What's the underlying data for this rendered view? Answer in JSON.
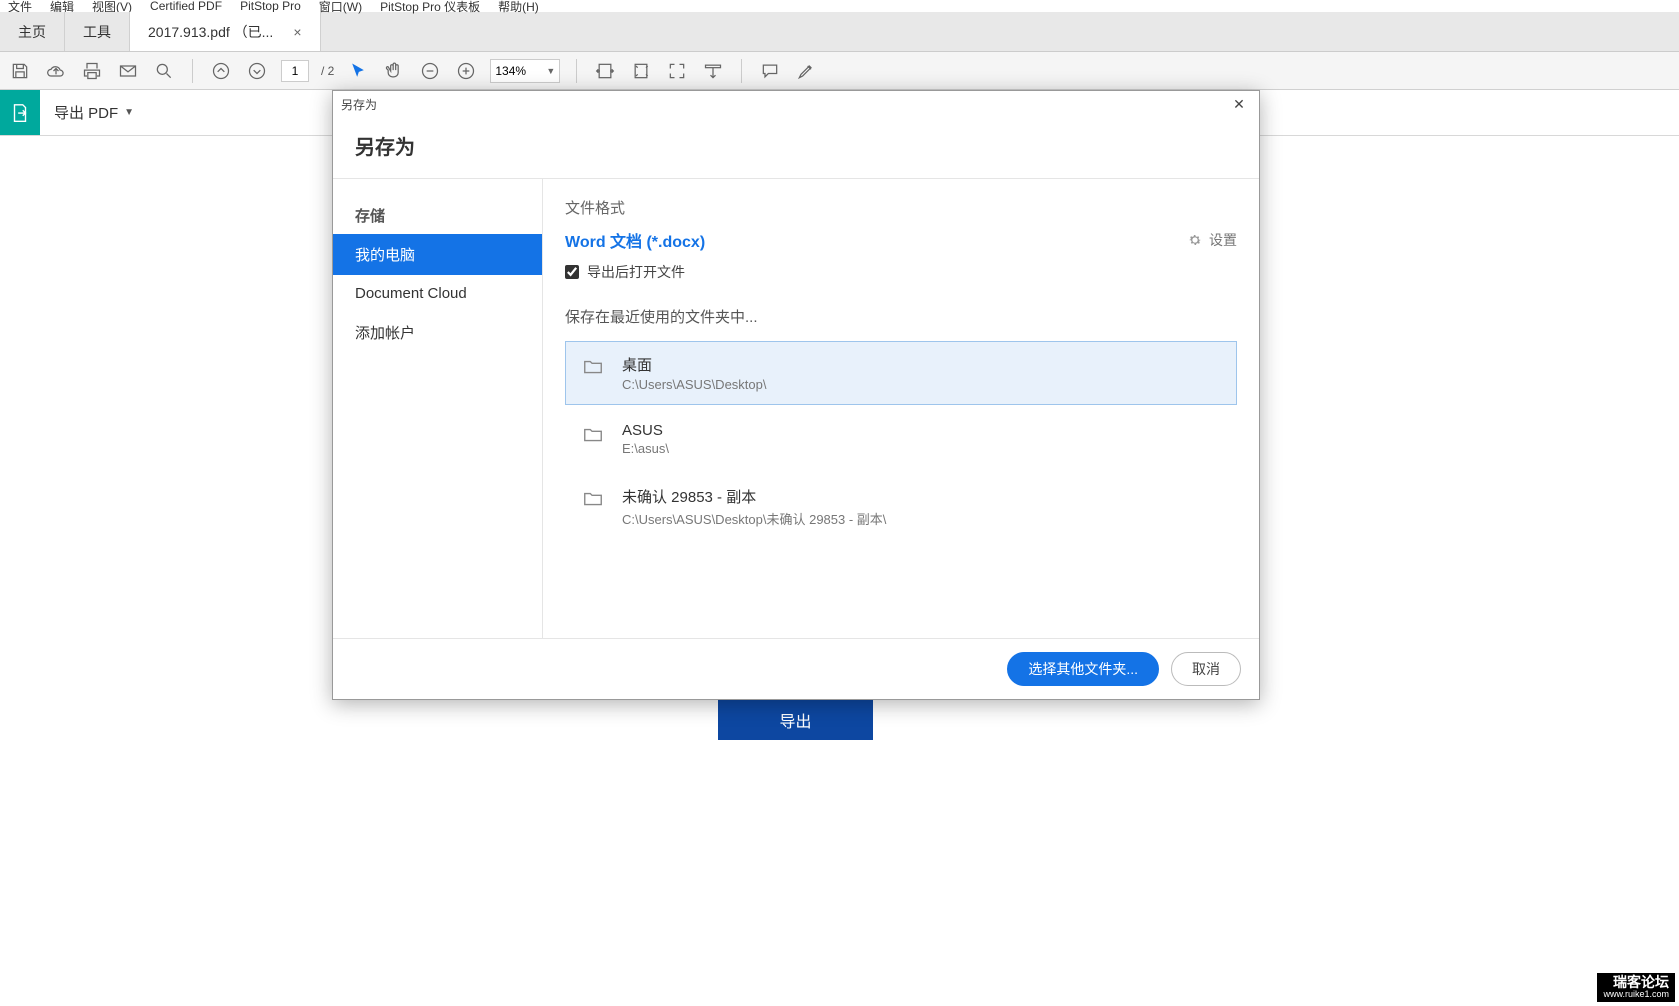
{
  "menubar": [
    "文件",
    "编辑",
    "视图(V)",
    "Certified PDF",
    "PitStop Pro",
    "窗口(W)",
    "PitStop Pro 仪表板",
    "帮助(H)"
  ],
  "tabs": {
    "home": "主页",
    "tools": "工具",
    "doc": "2017.913.pdf （已...",
    "close": "×"
  },
  "toolbar": {
    "pageCurrent": "1",
    "pageTotal": "/ 2",
    "zoom": "134%"
  },
  "exportbar": {
    "label": "导出 PDF"
  },
  "hiddenExportBtn": "导出",
  "dialog": {
    "titlebar": "另存为",
    "title": "另存为",
    "sidebar": {
      "section": "存储",
      "items": [
        "我的电脑",
        "Document Cloud",
        "添加帐户"
      ],
      "selectedIndex": 0
    },
    "main": {
      "formatLabel": "文件格式",
      "formatValue": "Word 文档 (*.docx)",
      "settings": "设置",
      "openAfter": "导出后打开文件",
      "openAfterChecked": true,
      "recentLabel": "保存在最近使用的文件夹中...",
      "folders": [
        {
          "name": "桌面",
          "path": "C:\\Users\\ASUS\\Desktop\\"
        },
        {
          "name": "ASUS",
          "path": "E:\\asus\\"
        },
        {
          "name": "未确认 29853 - 副本",
          "path": "C:\\Users\\ASUS\\Desktop\\未确认 29853 - 副本\\"
        }
      ],
      "selectedFolder": 0
    },
    "footer": {
      "chooseOther": "选择其他文件夹...",
      "cancel": "取消"
    }
  },
  "watermark": {
    "main": "瑞客论坛",
    "sub": "www.ruike1.com"
  }
}
